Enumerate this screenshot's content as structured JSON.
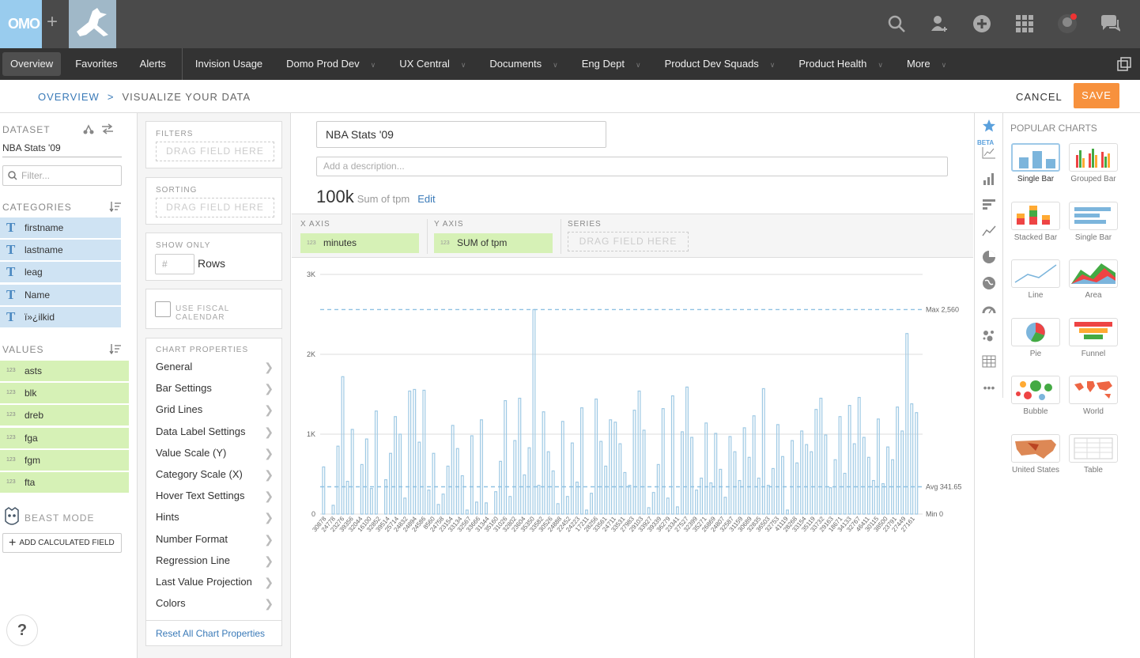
{
  "topbar": {
    "logo_text": "OMO",
    "plus": "+"
  },
  "nav": {
    "items": [
      {
        "label": "Overview",
        "active": true,
        "caret": false
      },
      {
        "label": "Favorites",
        "caret": false
      },
      {
        "label": "Alerts",
        "caret": false
      },
      {
        "label": "Invision Usage",
        "caret": false
      },
      {
        "label": "Domo Prod Dev",
        "caret": true
      },
      {
        "label": "UX Central",
        "caret": true
      },
      {
        "label": "Documents",
        "caret": true
      },
      {
        "label": "Eng Dept",
        "caret": true
      },
      {
        "label": "Product Dev Squads",
        "caret": true
      },
      {
        "label": "Product Health",
        "caret": true
      },
      {
        "label": "More",
        "caret": true
      }
    ]
  },
  "breadcrumb": {
    "root": "OVERVIEW",
    "sep": ">",
    "current": "VISUALIZE YOUR DATA"
  },
  "actions": {
    "cancel": "CANCEL",
    "save": "SAVE"
  },
  "dataset": {
    "heading": "DATASET",
    "name": "NBA Stats '09",
    "filter_placeholder": "Filter...",
    "categories_heading": "CATEGORIES",
    "categories": [
      "firstname",
      "lastname",
      "leag",
      "Name",
      "ï»¿ilkid"
    ],
    "values_heading": "VALUES",
    "values": [
      "asts",
      "blk",
      "dreb",
      "fga",
      "fgm",
      "fta"
    ],
    "beast_mode": "BEAST MODE",
    "add_calc": "ADD CALCULATED FIELD",
    "num_badge": "123",
    "type_badge": "T"
  },
  "config": {
    "filters": "FILTERS",
    "sorting": "SORTING",
    "drag": "DRAG FIELD HERE",
    "show_only": "SHOW ONLY",
    "rows_placeholder": "#",
    "rows": "Rows",
    "fiscal": "USE FISCAL CALENDAR",
    "chart_props": "CHART PROPERTIES",
    "props": [
      "General",
      "Bar Settings",
      "Grid Lines",
      "Data Label Settings",
      "Value Scale (Y)",
      "Category Scale (X)",
      "Hover Text Settings",
      "Hints",
      "Number Format",
      "Regression Line",
      "Last Value Projection",
      "Colors"
    ],
    "reset": "Reset All Chart Properties"
  },
  "card": {
    "title": "NBA Stats '09",
    "desc_placeholder": "Add a description...",
    "summary_value": "100k",
    "summary_label": "Sum of tpm",
    "edit": "Edit",
    "x_label": "X AXIS",
    "x_field": "minutes",
    "y_label": "Y AXIS",
    "y_field": "SUM of tpm",
    "series_label": "SERIES",
    "series_drag": "DRAG FIELD HERE"
  },
  "chart_data": {
    "type": "bar",
    "title": "",
    "xlabel": "",
    "ylabel": "",
    "ylim": [
      0,
      3000
    ],
    "yticks": [
      "0",
      "1K",
      "2K",
      "3K"
    ],
    "grid": true,
    "bar_color": "#9ec9e4",
    "categories": [
      "30878",
      "24778",
      "23276",
      "39356",
      "32044",
      "16100",
      "32852",
      "39514",
      "25714",
      "24832",
      "24894",
      "24586",
      "8560",
      "24758",
      "23154",
      "33134",
      "32567",
      "33666",
      "31344",
      "35160",
      "31026",
      "32802",
      "23604",
      "35350",
      "33582",
      "30526",
      "24888",
      "22452",
      "24223",
      "17211",
      "28256",
      "33561",
      "24711",
      "33531",
      "27983",
      "29103",
      "33927",
      "39339",
      "36279",
      "23341",
      "27527",
      "32399",
      "35271",
      "26869",
      "24807",
      "32587",
      "31159",
      "30689",
      "32835",
      "36503",
      "32753",
      "41119",
      "28268",
      "33154",
      "35119",
      "33732",
      "29163",
      "18671",
      "34133",
      "32767",
      "46411",
      "30115",
      "38500",
      "23791",
      "27449",
      "27161"
    ],
    "values": [
      590,
      0,
      110,
      850,
      1720,
      410,
      1060,
      0,
      620,
      940,
      320,
      1290,
      0,
      430,
      760,
      1220,
      1000,
      200,
      1540,
      1560,
      900,
      1550,
      300,
      760,
      120,
      250,
      600,
      1110,
      820,
      480,
      50,
      980,
      150,
      1180,
      140,
      0,
      280,
      660,
      1420,
      220,
      920,
      1450,
      490,
      830,
      2560,
      360,
      1280,
      780,
      540,
      130,
      1160,
      220,
      890,
      400,
      1330,
      50,
      260,
      1440,
      910,
      600,
      1180,
      1150,
      880,
      520,
      360,
      1300,
      1540,
      1050,
      80,
      270,
      620,
      1320,
      200,
      1480,
      90,
      1030,
      1590,
      960,
      300,
      450,
      1140,
      390,
      1010,
      560,
      210,
      970,
      780,
      420,
      1080,
      710,
      1230,
      450,
      1570,
      360,
      570,
      1120,
      720,
      50,
      920,
      640,
      1040,
      870,
      780,
      1310,
      1450,
      990,
      330,
      680,
      1220,
      510,
      1360,
      880,
      1460,
      960,
      710,
      420,
      1190,
      380,
      840,
      680,
      1340,
      1040,
      2260,
      1380,
      1270
    ],
    "lines": [
      {
        "label": "Max 2,560",
        "value": 2560
      },
      {
        "label": "Avg 341.65",
        "value": 341.65
      },
      {
        "label": "Min 0",
        "value": 0
      }
    ]
  },
  "charts_panel": {
    "heading": "POPULAR CHARTS",
    "beta": "BETA",
    "items": [
      {
        "label": "Single Bar",
        "selected": true
      },
      {
        "label": "Grouped Bar"
      },
      {
        "label": "Stacked Bar"
      },
      {
        "label": "Single Bar"
      },
      {
        "label": "Line"
      },
      {
        "label": "Area"
      },
      {
        "label": "Pie"
      },
      {
        "label": "Funnel"
      },
      {
        "label": "Bubble"
      },
      {
        "label": "World"
      },
      {
        "label": "United States"
      },
      {
        "label": "Table"
      }
    ]
  },
  "help": "?"
}
